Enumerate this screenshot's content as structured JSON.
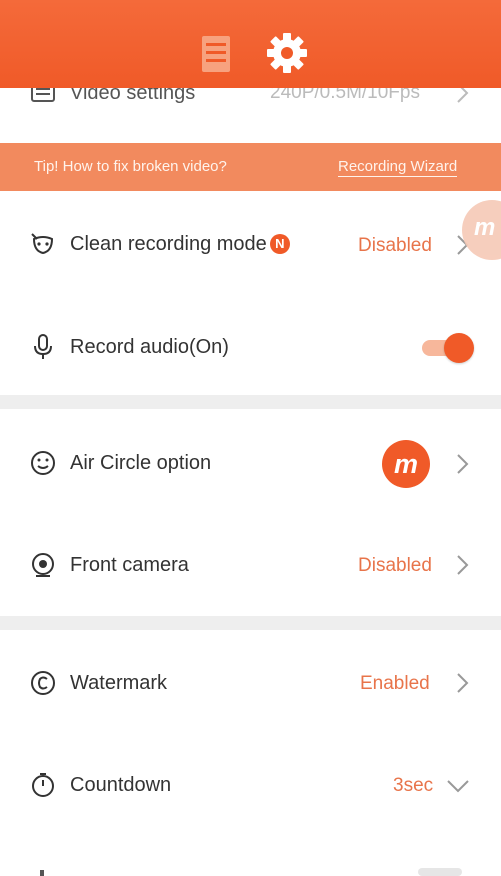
{
  "header": {
    "icons": [
      "list-icon",
      "gear-icon"
    ]
  },
  "video_settings": {
    "label": "Video settings",
    "value": "240P/0.5M/10Fps"
  },
  "banner": {
    "tip": "Tip! How to fix broken video?",
    "wizard": "Recording Wizard"
  },
  "fab": {
    "glyph": "m"
  },
  "settings": {
    "clean_recording": {
      "label": "Clean recording mode",
      "badge": "N",
      "value": "Disabled"
    },
    "record_audio": {
      "label": "Record audio(On)",
      "toggle_on": true
    },
    "air_circle": {
      "label": "Air Circle option",
      "logo_glyph": "m"
    },
    "front_camera": {
      "label": "Front camera",
      "value": "Disabled"
    },
    "watermark": {
      "label": "Watermark",
      "value": "Enabled"
    },
    "countdown": {
      "label": "Countdown",
      "value": "3sec"
    }
  },
  "colors": {
    "accent": "#f05a28",
    "value_text": "#e8744a",
    "banner": "#f28a5e",
    "divider": "#eeeeee"
  }
}
